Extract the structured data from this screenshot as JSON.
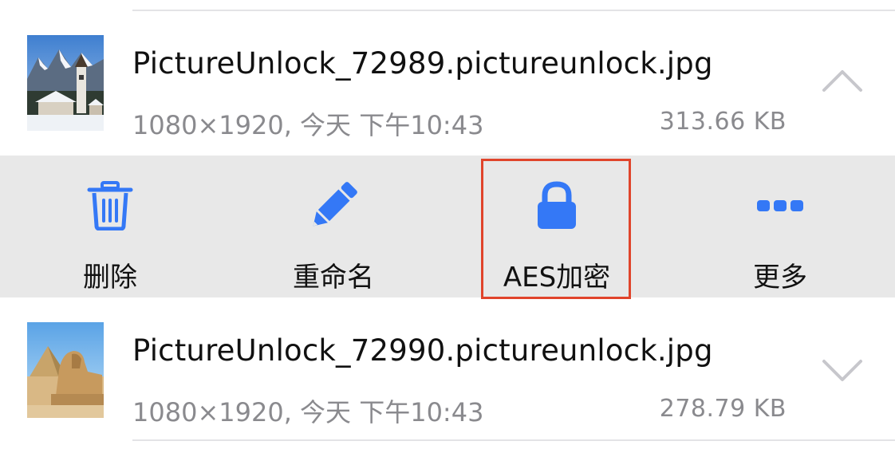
{
  "files": [
    {
      "name": "PictureUnlock_72989.pictureunlock.jpg",
      "meta": "1080×1920, 今天 下午10:43",
      "size": "313.66 KB",
      "thumbnail": "snowy-mountain-village-church",
      "expanded": true,
      "chevron_icon": "chevron-up-icon"
    },
    {
      "name": "PictureUnlock_72990.pictureunlock.jpg",
      "meta": "1080×1920, 今天 下午10:43",
      "size": "278.79 KB",
      "thumbnail": "sphinx-and-pyramid",
      "expanded": false,
      "chevron_icon": "chevron-down-icon"
    }
  ],
  "actions": [
    {
      "label": "删除",
      "icon": "trash-icon"
    },
    {
      "label": "重命名",
      "icon": "pencil-icon"
    },
    {
      "label": "AES加密",
      "icon": "lock-icon",
      "highlighted": true
    },
    {
      "label": "更多",
      "icon": "more-dots-icon"
    }
  ],
  "colors": {
    "accent": "#3478f6",
    "action_bar_bg": "#e8e8e8",
    "highlight_border": "#e0442b",
    "secondary_text": "#8a8a8e",
    "chevron": "#c7c7cc"
  }
}
